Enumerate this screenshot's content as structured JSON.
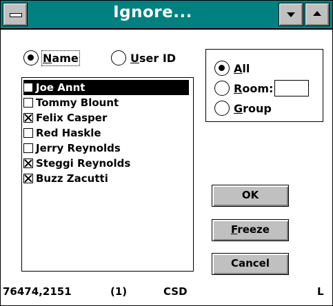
{
  "window": {
    "title": "Ignore...",
    "icons": {
      "system_menu": "system-menu-icon",
      "minimize": "minimize-icon",
      "maximize": "maximize-icon"
    }
  },
  "search_by": {
    "options": [
      {
        "label_pre": "",
        "label_ul": "N",
        "label_post": "ame",
        "selected": true
      },
      {
        "label_pre": "",
        "label_ul": "U",
        "label_post": "ser ID",
        "selected": false
      }
    ]
  },
  "users": [
    {
      "name": "Joe Annt",
      "checked": false,
      "selected": true
    },
    {
      "name": "Tommy Blount",
      "checked": false,
      "selected": false
    },
    {
      "name": "Felix Casper",
      "checked": true,
      "selected": false
    },
    {
      "name": "Red Haskle",
      "checked": false,
      "selected": false
    },
    {
      "name": "Jerry Reynolds",
      "checked": false,
      "selected": false
    },
    {
      "name": "Steggi Reynolds",
      "checked": true,
      "selected": false
    },
    {
      "name": "Buzz Zacutti",
      "checked": true,
      "selected": false
    }
  ],
  "scope": {
    "options": [
      {
        "label_ul": "A",
        "label_post": "ll",
        "selected": true
      },
      {
        "label_ul": "R",
        "label_post": "oom:",
        "selected": false
      },
      {
        "label_ul": "G",
        "label_post": "roup",
        "selected": false
      }
    ],
    "room_value": ""
  },
  "buttons": {
    "ok": {
      "label": "OK"
    },
    "freeze": {
      "label_ul": "F",
      "label_post": "reeze"
    },
    "cancel": {
      "label": "Cancel"
    }
  },
  "status": {
    "user_id": "76474,2151",
    "count": "(1)",
    "service": "CSD",
    "indicator": "L"
  }
}
